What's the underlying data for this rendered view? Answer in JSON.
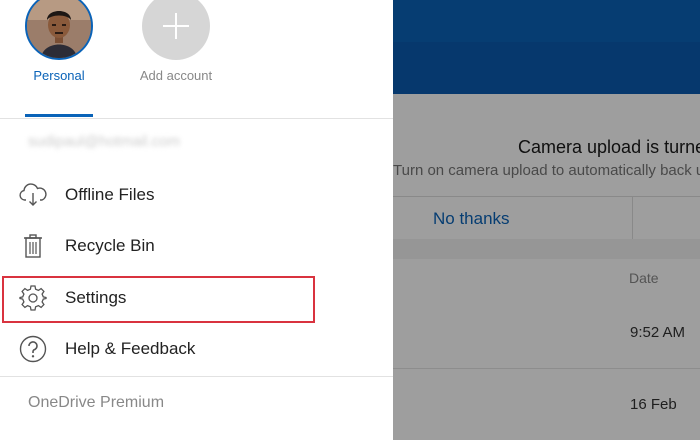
{
  "drawer": {
    "accounts": {
      "personal_label": "Personal",
      "add_label": "Add account"
    },
    "email_blurred": "sudipaul@hotmail.com",
    "menu": {
      "offline": "Offline Files",
      "recycle": "Recycle Bin",
      "settings": "Settings",
      "help": "Help & Feedback"
    },
    "premium": "OneDrive Premium",
    "icons": {
      "avatar": "user-avatar-photo",
      "add": "plus-icon",
      "offline": "cloud-download-icon",
      "recycle": "trash-icon",
      "settings": "gear-icon",
      "help": "question-icon"
    }
  },
  "background": {
    "banner_title": "Camera upload is turne",
    "banner_subtitle": "Turn on camera upload to automatically back u",
    "no_thanks": "No thanks",
    "column_date": "Date",
    "rows": [
      "9:52 AM",
      "16 Feb"
    ]
  },
  "colors": {
    "accent": "#0a63b8",
    "highlight_border": "#d9333f"
  }
}
